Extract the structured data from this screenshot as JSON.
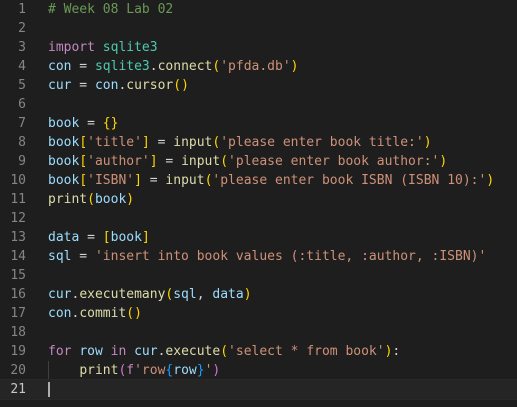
{
  "editor": {
    "colors": {
      "background": "#1e1e1e",
      "comment": "#6a9955",
      "keyword": "#c586c0",
      "module": "#4ec9b0",
      "variable": "#9cdcfe",
      "function": "#dcdcaa",
      "string": "#ce9178",
      "plain": "#d4d4d4",
      "bracket1": "#ffd700",
      "bracket2": "#da70d6",
      "bracket3": "#179fff",
      "line_number": "#858585",
      "line_number_active": "#c6c6c6"
    },
    "current_line": 21,
    "lines": [
      {
        "n": "1",
        "tokens": [
          {
            "t": "# Week 08 Lab 02",
            "c": "comment"
          }
        ]
      },
      {
        "n": "2",
        "tokens": []
      },
      {
        "n": "3",
        "tokens": [
          {
            "t": "import",
            "c": "keyword"
          },
          {
            "t": " ",
            "c": "plain"
          },
          {
            "t": "sqlite3",
            "c": "module"
          }
        ]
      },
      {
        "n": "4",
        "tokens": [
          {
            "t": "con",
            "c": "variable"
          },
          {
            "t": " = ",
            "c": "plain"
          },
          {
            "t": "sqlite3",
            "c": "module"
          },
          {
            "t": ".",
            "c": "plain"
          },
          {
            "t": "connect",
            "c": "function"
          },
          {
            "t": "(",
            "c": "bracket1"
          },
          {
            "t": "'pfda.db'",
            "c": "string"
          },
          {
            "t": ")",
            "c": "bracket1"
          }
        ]
      },
      {
        "n": "5",
        "tokens": [
          {
            "t": "cur",
            "c": "variable"
          },
          {
            "t": " = ",
            "c": "plain"
          },
          {
            "t": "con",
            "c": "variable"
          },
          {
            "t": ".",
            "c": "plain"
          },
          {
            "t": "cursor",
            "c": "function"
          },
          {
            "t": "()",
            "c": "bracket1"
          }
        ]
      },
      {
        "n": "6",
        "tokens": []
      },
      {
        "n": "7",
        "tokens": [
          {
            "t": "book",
            "c": "variable"
          },
          {
            "t": " = ",
            "c": "plain"
          },
          {
            "t": "{}",
            "c": "bracket1"
          }
        ]
      },
      {
        "n": "8",
        "tokens": [
          {
            "t": "book",
            "c": "variable"
          },
          {
            "t": "[",
            "c": "bracket1"
          },
          {
            "t": "'title'",
            "c": "string"
          },
          {
            "t": "]",
            "c": "bracket1"
          },
          {
            "t": " = ",
            "c": "plain"
          },
          {
            "t": "input",
            "c": "function"
          },
          {
            "t": "(",
            "c": "bracket1"
          },
          {
            "t": "'please enter book title:'",
            "c": "string"
          },
          {
            "t": ")",
            "c": "bracket1"
          }
        ]
      },
      {
        "n": "9",
        "tokens": [
          {
            "t": "book",
            "c": "variable"
          },
          {
            "t": "[",
            "c": "bracket1"
          },
          {
            "t": "'author'",
            "c": "string"
          },
          {
            "t": "]",
            "c": "bracket1"
          },
          {
            "t": " = ",
            "c": "plain"
          },
          {
            "t": "input",
            "c": "function"
          },
          {
            "t": "(",
            "c": "bracket1"
          },
          {
            "t": "'please enter book author:'",
            "c": "string"
          },
          {
            "t": ")",
            "c": "bracket1"
          }
        ]
      },
      {
        "n": "10",
        "tokens": [
          {
            "t": "book",
            "c": "variable"
          },
          {
            "t": "[",
            "c": "bracket1"
          },
          {
            "t": "'ISBN'",
            "c": "string"
          },
          {
            "t": "]",
            "c": "bracket1"
          },
          {
            "t": " = ",
            "c": "plain"
          },
          {
            "t": "input",
            "c": "function"
          },
          {
            "t": "(",
            "c": "bracket1"
          },
          {
            "t": "'please enter book ISBN (ISBN 10):'",
            "c": "string"
          },
          {
            "t": ")",
            "c": "bracket1"
          }
        ]
      },
      {
        "n": "11",
        "tokens": [
          {
            "t": "print",
            "c": "function"
          },
          {
            "t": "(",
            "c": "bracket1"
          },
          {
            "t": "book",
            "c": "variable"
          },
          {
            "t": ")",
            "c": "bracket1"
          }
        ]
      },
      {
        "n": "12",
        "tokens": []
      },
      {
        "n": "13",
        "tokens": [
          {
            "t": "data",
            "c": "variable"
          },
          {
            "t": " = ",
            "c": "plain"
          },
          {
            "t": "[",
            "c": "bracket1"
          },
          {
            "t": "book",
            "c": "variable"
          },
          {
            "t": "]",
            "c": "bracket1"
          }
        ]
      },
      {
        "n": "14",
        "tokens": [
          {
            "t": "sql",
            "c": "variable"
          },
          {
            "t": " = ",
            "c": "plain"
          },
          {
            "t": "'insert into book values (:title, :author, :ISBN)'",
            "c": "string"
          }
        ]
      },
      {
        "n": "15",
        "tokens": []
      },
      {
        "n": "16",
        "tokens": [
          {
            "t": "cur",
            "c": "variable"
          },
          {
            "t": ".",
            "c": "plain"
          },
          {
            "t": "executemany",
            "c": "function"
          },
          {
            "t": "(",
            "c": "bracket1"
          },
          {
            "t": "sql",
            "c": "variable"
          },
          {
            "t": ", ",
            "c": "plain"
          },
          {
            "t": "data",
            "c": "variable"
          },
          {
            "t": ")",
            "c": "bracket1"
          }
        ]
      },
      {
        "n": "17",
        "tokens": [
          {
            "t": "con",
            "c": "variable"
          },
          {
            "t": ".",
            "c": "plain"
          },
          {
            "t": "commit",
            "c": "function"
          },
          {
            "t": "()",
            "c": "bracket1"
          }
        ]
      },
      {
        "n": "18",
        "tokens": []
      },
      {
        "n": "19",
        "tokens": [
          {
            "t": "for",
            "c": "keyword"
          },
          {
            "t": " ",
            "c": "plain"
          },
          {
            "t": "row",
            "c": "variable"
          },
          {
            "t": " ",
            "c": "plain"
          },
          {
            "t": "in",
            "c": "keyword"
          },
          {
            "t": " ",
            "c": "plain"
          },
          {
            "t": "cur",
            "c": "variable"
          },
          {
            "t": ".",
            "c": "plain"
          },
          {
            "t": "execute",
            "c": "function"
          },
          {
            "t": "(",
            "c": "bracket1"
          },
          {
            "t": "'select * from book'",
            "c": "string"
          },
          {
            "t": ")",
            "c": "bracket1"
          },
          {
            "t": ":",
            "c": "plain"
          }
        ]
      },
      {
        "n": "20",
        "indent": true,
        "tokens": [
          {
            "t": "    ",
            "c": "plain"
          },
          {
            "t": "print",
            "c": "function"
          },
          {
            "t": "(",
            "c": "bracket2"
          },
          {
            "t": "f",
            "c": "keyword"
          },
          {
            "t": "'row",
            "c": "string"
          },
          {
            "t": "{",
            "c": "bracket3"
          },
          {
            "t": "row",
            "c": "variable"
          },
          {
            "t": "}",
            "c": "bracket3"
          },
          {
            "t": "'",
            "c": "string"
          },
          {
            "t": ")",
            "c": "bracket2"
          }
        ]
      },
      {
        "n": "21",
        "tokens": []
      }
    ]
  }
}
